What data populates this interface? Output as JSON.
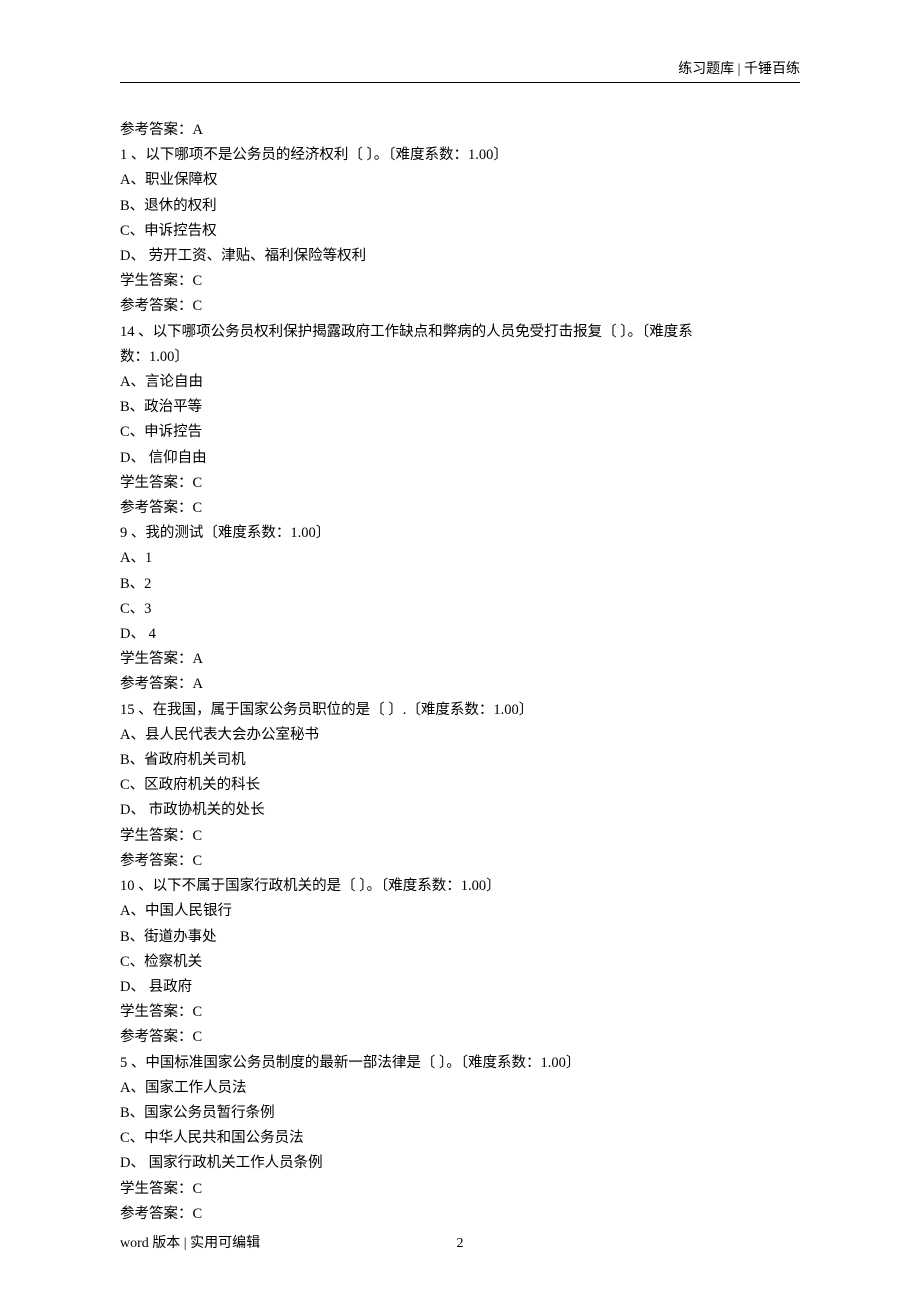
{
  "header": {
    "right": "练习题库 | 千锤百练"
  },
  "footer": {
    "left": "word 版本 | 实用可编辑",
    "page": "2"
  },
  "lines": [
    "参考答案：A",
    "1 、以下哪项不是公务员的经济权利〔  〕。〔难度系数：1.00〕",
    "A、职业保障权",
    "B、退休的权利",
    "C、申诉控告权",
    "D、 劳开工资、津贴、福利保险等权利",
    "学生答案：C",
    "参考答案：C",
    "14 、以下哪项公务员权利保护揭露政府工作缺点和弊病的人员免受打击报复〔  〕。〔难度系",
    "数：1.00〕",
    "A、言论自由",
    "B、政治平等",
    "C、申诉控告",
    "D、 信仰自由",
    "学生答案：C",
    "参考答案：C",
    "9 、我的测试〔难度系数：1.00〕",
    "A、1",
    "B、2",
    "C、3",
    "D、 4",
    "学生答案：A",
    "参考答案：A",
    "15 、在我国，属于国家公务员职位的是〔  〕.〔难度系数：1.00〕",
    "A、县人民代表大会办公室秘书",
    "B、省政府机关司机",
    "C、区政府机关的科长",
    "D、 市政协机关的处长",
    "学生答案：C",
    "参考答案：C",
    "10 、以下不属于国家行政机关的是〔  〕。〔难度系数：1.00〕",
    "A、中国人民银行",
    "B、街道办事处",
    "C、检察机关",
    "D、 县政府",
    "学生答案：C",
    "参考答案：C",
    "5 、中国标准国家公务员制度的最新一部法律是〔  〕。〔难度系数：1.00〕",
    "A、国家工作人员法",
    "B、国家公务员暂行条例",
    "C、中华人民共和国公务员法",
    "D、 国家行政机关工作人员条例",
    "学生答案：C",
    "参考答案：C"
  ]
}
